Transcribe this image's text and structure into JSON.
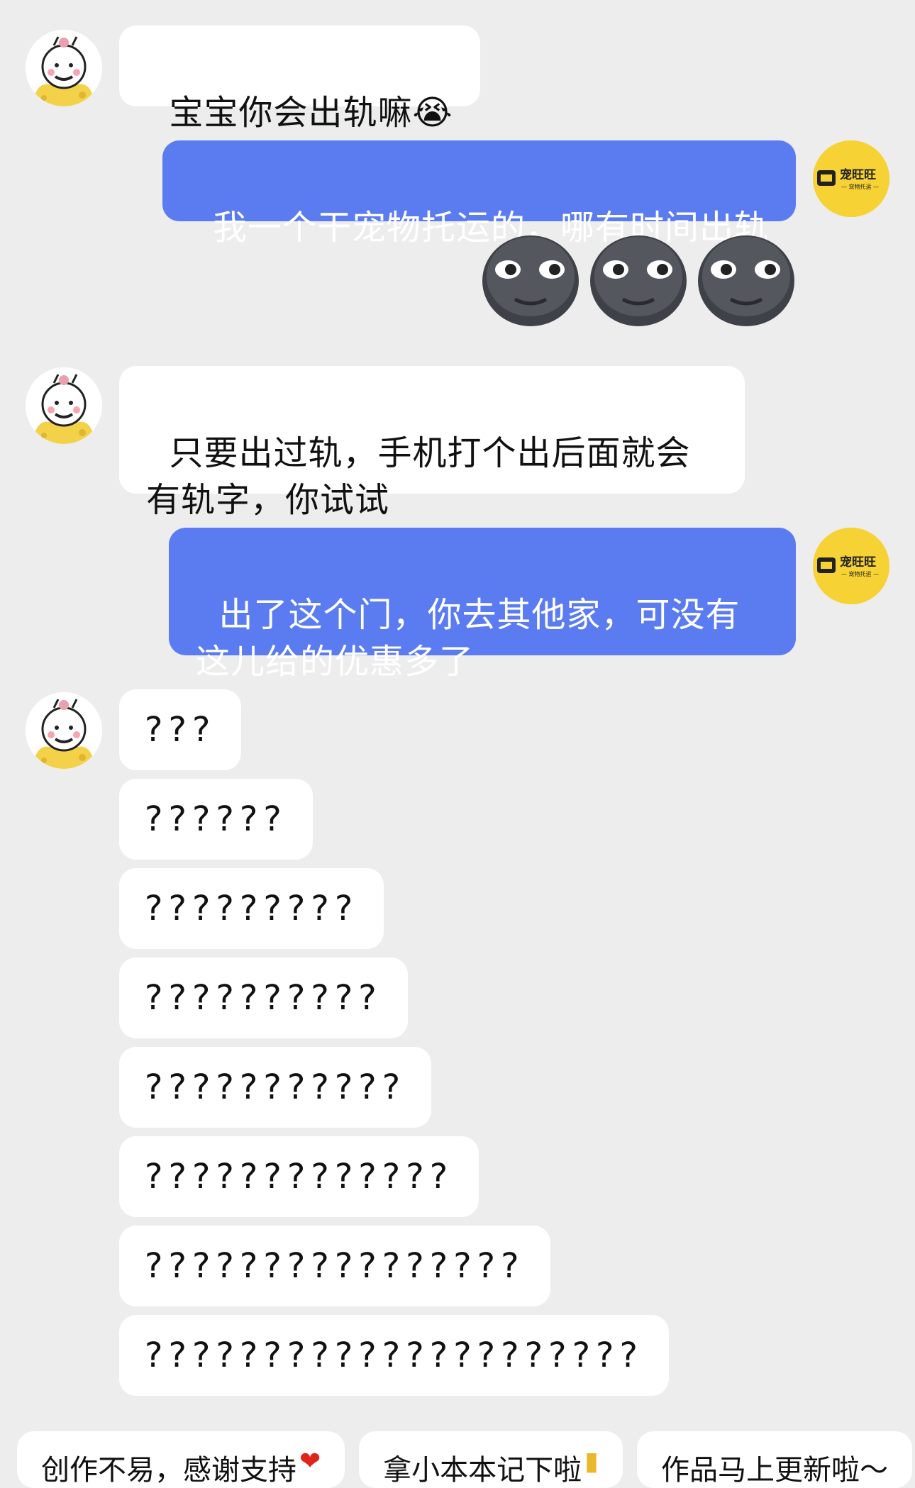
{
  "messages": [
    {
      "side": "left",
      "text": "宝宝你会出轨嘛",
      "emoji": "😭"
    },
    {
      "side": "right",
      "text": "我一个干宠物托运的，哪有时间出轨"
    },
    {
      "side": "left",
      "text": "只要出过轨，手机打个出后面就会有轨字，你试试"
    },
    {
      "side": "right",
      "text": "出了这个门，你去其他家，可没有这儿给的优惠多了"
    }
  ],
  "question_bubbles": [
    "???",
    "??????",
    "?????????",
    "??????????",
    "???????????",
    "?????????????",
    "????????????????",
    "?????????????????????"
  ],
  "brand": {
    "name": "宠旺旺",
    "sub": "— 宠物托运 —"
  },
  "suggestions": [
    {
      "text": "创作不易，感谢支持",
      "icon": "heart-icon"
    },
    {
      "text": "拿小本本记下啦",
      "icon": "notebook-icon"
    },
    {
      "text": "作品马上更新啦～"
    }
  ],
  "colors": {
    "background": "#ededed",
    "right_bubble": "#5b7cf0",
    "left_bubble": "#ffffff",
    "brand": "#f6d234"
  }
}
